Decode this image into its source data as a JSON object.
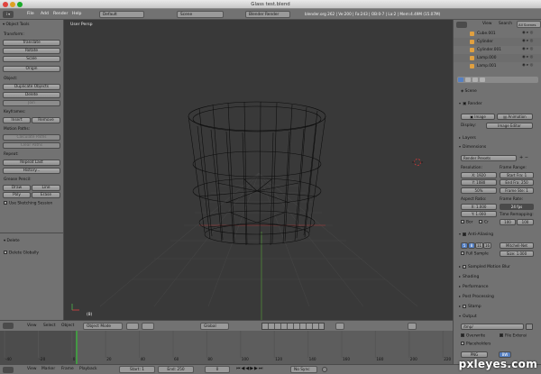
{
  "window": {
    "title": "Glass test.blend"
  },
  "info_header": {
    "menus": [
      "File",
      "Add",
      "Render",
      "Help"
    ],
    "layout": "Default",
    "scene": "Scene",
    "render_engine": "Blender Render",
    "stats": "blender.org 262 | Ve:200 | Fa:243 | OB:0-7 | La:2 | Mem:4.49M (15.07M)"
  },
  "toolshelf": {
    "title": "Object Tools",
    "transform_label": "Transform:",
    "translate": "Translate",
    "rotate": "Rotate",
    "scale": "Scale",
    "origin": "Origin",
    "object_label": "Object:",
    "duplicate": "Duplicate Objects",
    "delete": "Delete",
    "join": "Join",
    "keyframes_label": "Keyframes:",
    "insert": "Insert",
    "remove": "Remove",
    "motion_paths_label": "Motion Paths:",
    "calc_paths": "Calculate Paths",
    "clear_paths": "Clear Paths",
    "repeat_label": "Repeat:",
    "repeat_last": "Repeat Last",
    "history": "History...",
    "grease_label": "Grease Pencil:",
    "draw": "Draw",
    "line": "Line",
    "poly": "Poly",
    "erase": "Erase",
    "use_sketching": "Use Sketching Session",
    "op_title": "Delete",
    "delete_globally": "Delete Globally"
  },
  "viewport": {
    "label": "User Persp",
    "object_label": "(8)"
  },
  "view3d_header": {
    "menus": [
      "View",
      "Select",
      "Object"
    ],
    "mode": "Object Mode",
    "pivot": "Global"
  },
  "timeline": {
    "menus": [
      "View",
      "Marker",
      "Frame",
      "Playback"
    ],
    "start": "Start: 1",
    "end": "End: 250",
    "current": "0",
    "sync": "No Sync",
    "ticks": [
      "-40",
      "-20",
      "0",
      "20",
      "40",
      "60",
      "80",
      "100",
      "120",
      "140",
      "160",
      "180",
      "200",
      "220",
      "240",
      "260"
    ]
  },
  "outliner": {
    "menus": [
      "View",
      "Search",
      "All Scenes"
    ],
    "items": [
      "Cube.001",
      "Cylinder",
      "Cylinder.001",
      "Lamp.000",
      "Lamp.001"
    ]
  },
  "properties": {
    "context": "Scene",
    "render_section": "Render",
    "image_btn": "Image",
    "animation_btn": "Animation",
    "display_label": "Display:",
    "display_value": "Image Editor",
    "layers": "Layers",
    "dimensions": "Dimensions",
    "presets": "Render Presets",
    "resolution_label": "Resolution:",
    "res_x": "X: 1920",
    "res_y": "Y: 1080",
    "res_pct": "50%",
    "frame_range_label": "Frame Range:",
    "start_frame": "Start Fra: 1",
    "end_frame": "End Fra: 250",
    "frame_step": "Frame Ste: 1",
    "aspect_label": "Aspect Ratio:",
    "asp_x": "X: 1.000",
    "asp_y": "Y: 1.000",
    "frame_rate_label": "Frame Rate:",
    "fps": "24 fps",
    "time_remap_label": "Time Remapping:",
    "remap_old": "100",
    "remap_new": "100",
    "bor": "Bor",
    "crop": "Cr",
    "aa_section": "Anti-Aliasing",
    "aa_samples": [
      "5",
      "8",
      "11",
      "16"
    ],
    "aa_filter": "Mitchell-Net",
    "full_sample": "Full Sample",
    "aa_size": "Size: 1.000",
    "motion_blur": "Sampled Motion Blur",
    "shading": "Shading",
    "performance": "Performance",
    "post_processing": "Post Processing",
    "stamp": "Stamp",
    "output": "Output",
    "output_path": "/tmp/",
    "overwrite": "Overwrite",
    "file_ext": "File Extensi",
    "placeholders": "Placeholders",
    "format": "PNG",
    "bw": "BW"
  },
  "watermark": "pxleyes.com"
}
